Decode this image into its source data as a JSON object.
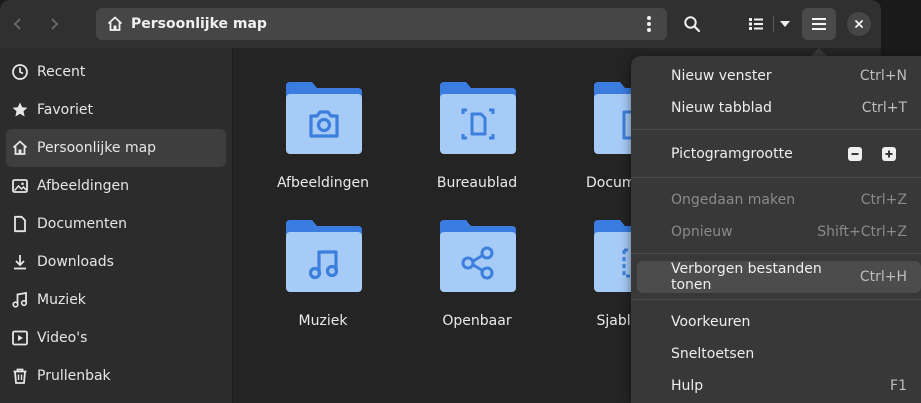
{
  "header": {
    "path_label": "Persoonlijke map"
  },
  "sidebar": {
    "items": [
      {
        "label": "Recent",
        "icon": "clock-icon"
      },
      {
        "label": "Favoriet",
        "icon": "star-icon"
      },
      {
        "label": "Persoonlijke map",
        "icon": "home-icon",
        "active": true
      },
      {
        "label": "Afbeeldingen",
        "icon": "image-icon"
      },
      {
        "label": "Documenten",
        "icon": "document-icon"
      },
      {
        "label": "Downloads",
        "icon": "download-icon"
      },
      {
        "label": "Muziek",
        "icon": "music-icon"
      },
      {
        "label": "Video's",
        "icon": "video-icon"
      },
      {
        "label": "Prullenbak",
        "icon": "trash-icon"
      }
    ]
  },
  "folders": [
    {
      "label": "Afbeeldingen",
      "icon": "camera-icon"
    },
    {
      "label": "Bureaublad",
      "icon": "desktop-icon"
    },
    {
      "label": "Documenten",
      "icon": "document-icon"
    },
    {
      "label": "Muziek",
      "icon": "music-icon"
    },
    {
      "label": "Openbaar",
      "icon": "share-icon"
    },
    {
      "label": "Sjablonen",
      "icon": "template-icon"
    }
  ],
  "menu": {
    "new_window": {
      "label": "Nieuw venster",
      "shortcut": "Ctrl+N"
    },
    "new_tab": {
      "label": "Nieuw tabblad",
      "shortcut": "Ctrl+T"
    },
    "icon_size": {
      "label": "Pictogramgrootte"
    },
    "undo": {
      "label": "Ongedaan maken",
      "shortcut": "Ctrl+Z"
    },
    "redo": {
      "label": "Opnieuw",
      "shortcut": "Shift+Ctrl+Z"
    },
    "show_hidden": {
      "label": "Verborgen bestanden tonen",
      "shortcut": "Ctrl+H"
    },
    "preferences": {
      "label": "Voorkeuren"
    },
    "shortcuts": {
      "label": "Sneltoetsen"
    },
    "help": {
      "label": "Hulp",
      "shortcut": "F1"
    }
  },
  "colors": {
    "folder_tab": "#3a7ce0",
    "folder_body": "#a6cbf6",
    "folder_glyph": "#3d7fdd"
  }
}
